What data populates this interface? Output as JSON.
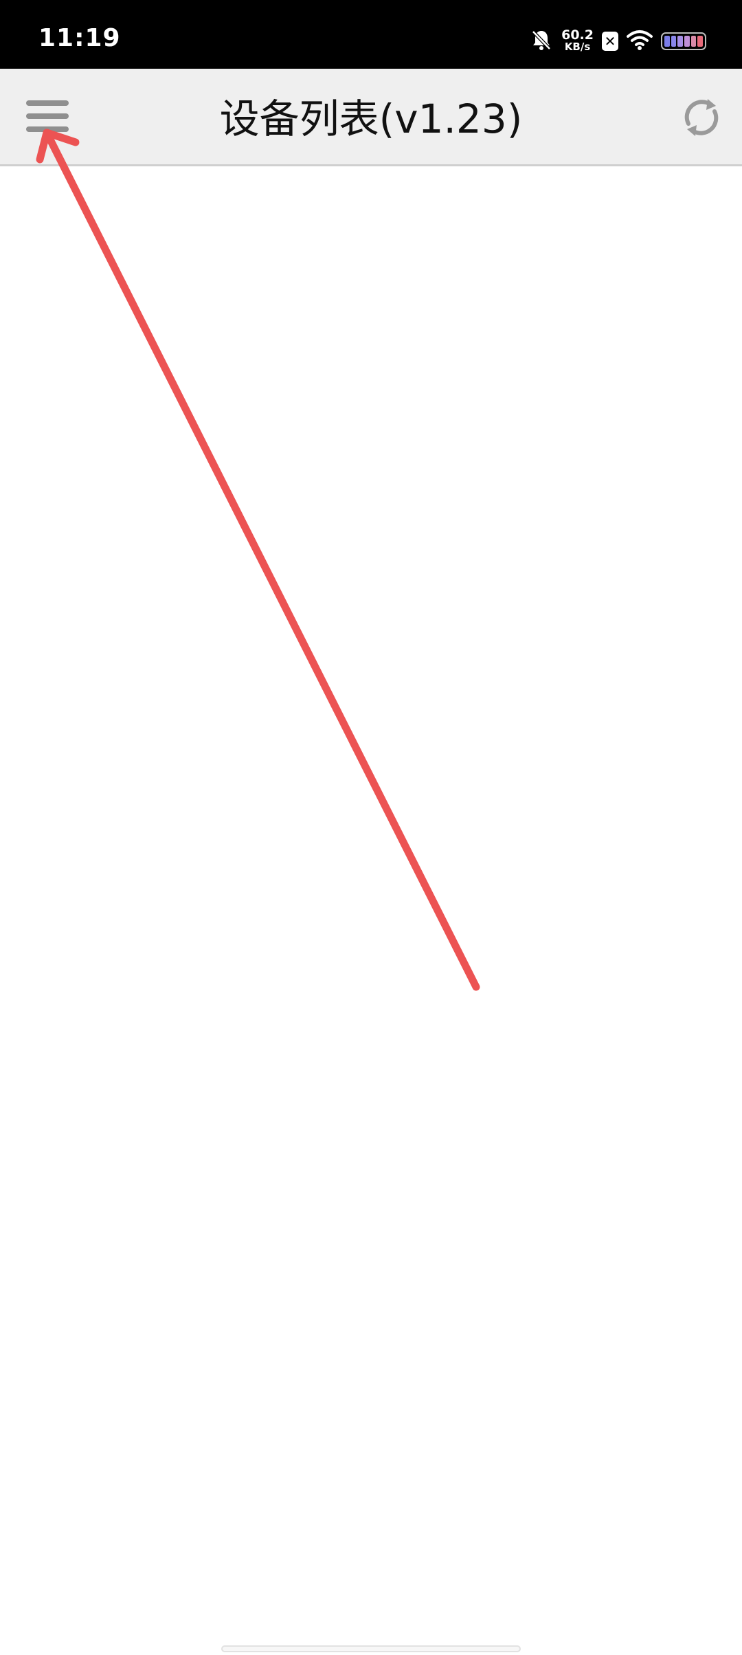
{
  "status_bar": {
    "time": "11:19",
    "net_speed_value": "60.2",
    "net_speed_unit": "KB/s",
    "icons": [
      "bell-off-icon",
      "nfc-icon",
      "wifi-icon",
      "battery-icon"
    ],
    "nfc_glyph": "✕",
    "battery_colors": [
      "#7b7de8",
      "#8a86ea",
      "#a78fe6",
      "#c090d8",
      "#d88aa8",
      "#e86a7a"
    ]
  },
  "app_bar": {
    "title": "设备列表(v1.23)",
    "menu_icon": "hamburger-menu-icon",
    "refresh_icon": "refresh-icon",
    "background": "#efefef"
  },
  "annotation": {
    "type": "arrow",
    "color": "#ec5353",
    "points_to": "menu-button"
  }
}
